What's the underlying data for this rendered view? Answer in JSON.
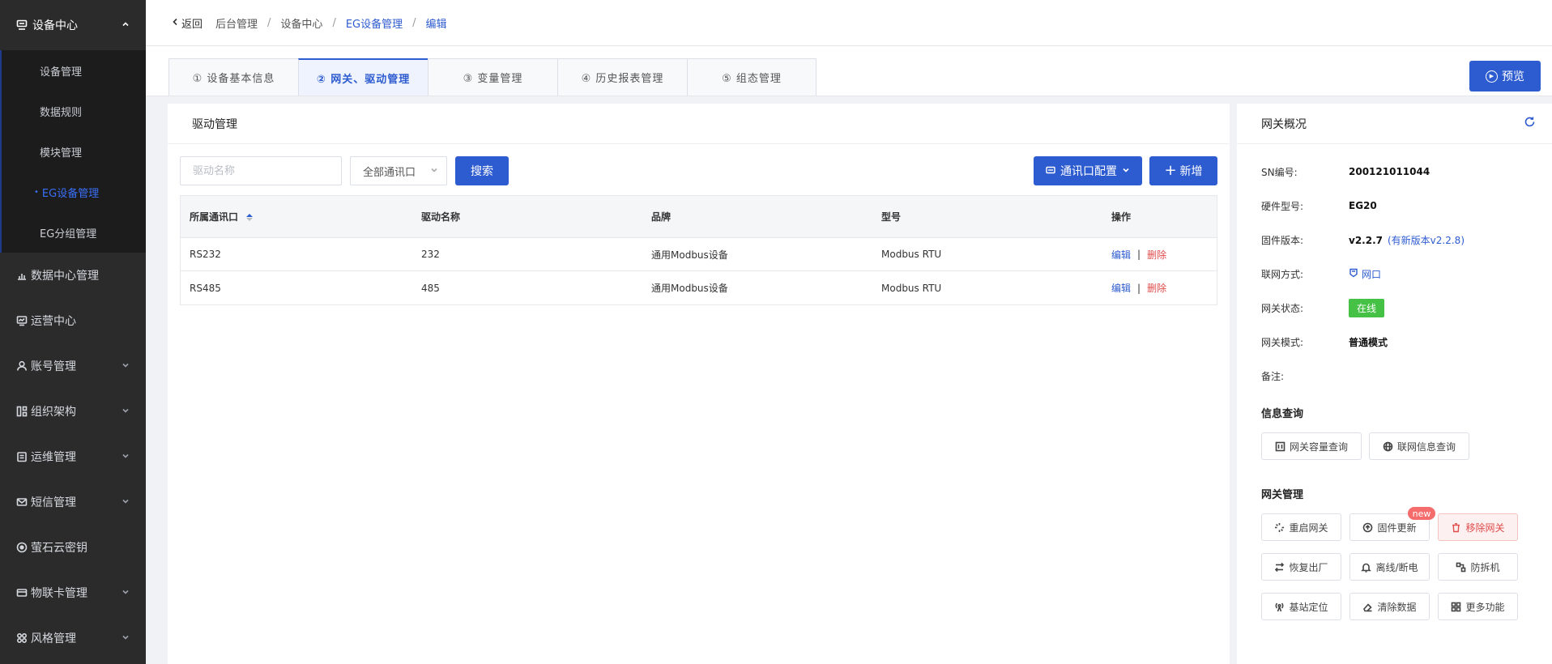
{
  "sidebar": {
    "group_title": "设备中心",
    "sub_items": [
      {
        "label": "设备管理"
      },
      {
        "label": "数据规则"
      },
      {
        "label": "模块管理"
      },
      {
        "label": "EG设备管理"
      },
      {
        "label": "EG分组管理"
      }
    ],
    "items": [
      {
        "label": "数据中心管理"
      },
      {
        "label": "运营中心"
      },
      {
        "label": "账号管理"
      },
      {
        "label": "组织架构"
      },
      {
        "label": "运维管理"
      },
      {
        "label": "短信管理"
      },
      {
        "label": "萤石云密钥"
      },
      {
        "label": "物联卡管理"
      },
      {
        "label": "风格管理"
      }
    ]
  },
  "breadcrumb": {
    "back_label": "返回",
    "items": [
      "后台管理",
      "设备中心",
      "EG设备管理",
      "编辑"
    ]
  },
  "tabs": [
    {
      "label": "① 设备基本信息"
    },
    {
      "label": "② 网关、驱动管理"
    },
    {
      "label": "③ 变量管理"
    },
    {
      "label": "④ 历史报表管理"
    },
    {
      "label": "⑤ 组态管理"
    }
  ],
  "preview_label": "预览",
  "driver": {
    "title": "驱动管理",
    "search_placeholder": "驱动名称",
    "port_select": "全部通讯口",
    "search_label": "搜索",
    "port_config_label": "通讯口配置",
    "add_label": "新增",
    "columns": [
      "所属通讯口",
      "驱动名称",
      "品牌",
      "型号",
      "操作"
    ],
    "rows": [
      {
        "port": "RS232",
        "name": "232",
        "brand": "通用Modbus设备",
        "model": "Modbus RTU"
      },
      {
        "port": "RS485",
        "name": "485",
        "brand": "通用Modbus设备",
        "model": "Modbus RTU"
      }
    ],
    "edit_label": "编辑",
    "op_separator": "|",
    "delete_label": "删除"
  },
  "gateway": {
    "title": "网关概况",
    "fields": {
      "sn_label": "SN编号:",
      "sn": "200121011044",
      "hw_label": "硬件型号:",
      "hw": "EG20",
      "fw_label": "固件版本:",
      "fw": "v2.2.7",
      "fw_new": "(有新版本v2.2.8)",
      "net_label": "联网方式:",
      "net": "网口",
      "status_label": "网关状态:",
      "status": "在线",
      "mode_label": "网关模式:",
      "mode": "普通模式",
      "remark_label": "备注:"
    },
    "info_query_title": "信息查询",
    "info_buttons": [
      "网关容量查询",
      "联网信息查询"
    ],
    "manage_title": "网关管理",
    "manage_buttons": [
      "重启网关",
      "固件更新",
      "移除网关",
      "恢复出厂",
      "离线/断电",
      "防拆机",
      "基站定位",
      "清除数据",
      "更多功能"
    ],
    "new_badge": "new"
  },
  "colors": {
    "primary": "#2d5bd0",
    "danger": "#e04b4b",
    "success": "#45c246",
    "sidebar_bg": "#2b2b2b"
  }
}
